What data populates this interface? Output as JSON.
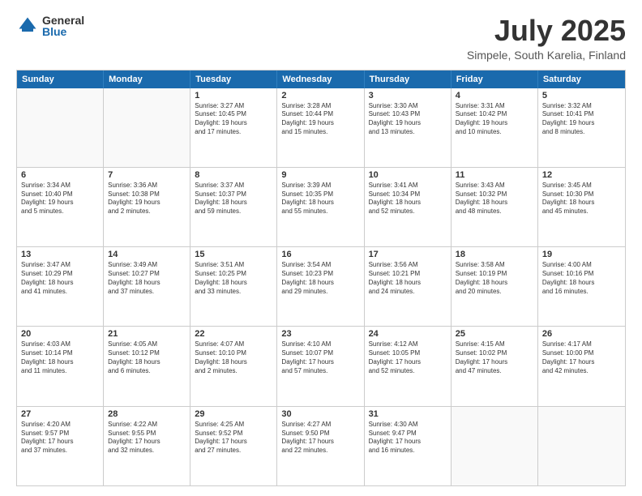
{
  "logo": {
    "general": "General",
    "blue": "Blue"
  },
  "title": "July 2025",
  "location": "Simpele, South Karelia, Finland",
  "days": [
    "Sunday",
    "Monday",
    "Tuesday",
    "Wednesday",
    "Thursday",
    "Friday",
    "Saturday"
  ],
  "weeks": [
    [
      {
        "day": "",
        "text": ""
      },
      {
        "day": "",
        "text": ""
      },
      {
        "day": "1",
        "text": "Sunrise: 3:27 AM\nSunset: 10:45 PM\nDaylight: 19 hours\nand 17 minutes."
      },
      {
        "day": "2",
        "text": "Sunrise: 3:28 AM\nSunset: 10:44 PM\nDaylight: 19 hours\nand 15 minutes."
      },
      {
        "day": "3",
        "text": "Sunrise: 3:30 AM\nSunset: 10:43 PM\nDaylight: 19 hours\nand 13 minutes."
      },
      {
        "day": "4",
        "text": "Sunrise: 3:31 AM\nSunset: 10:42 PM\nDaylight: 19 hours\nand 10 minutes."
      },
      {
        "day": "5",
        "text": "Sunrise: 3:32 AM\nSunset: 10:41 PM\nDaylight: 19 hours\nand 8 minutes."
      }
    ],
    [
      {
        "day": "6",
        "text": "Sunrise: 3:34 AM\nSunset: 10:40 PM\nDaylight: 19 hours\nand 5 minutes."
      },
      {
        "day": "7",
        "text": "Sunrise: 3:36 AM\nSunset: 10:38 PM\nDaylight: 19 hours\nand 2 minutes."
      },
      {
        "day": "8",
        "text": "Sunrise: 3:37 AM\nSunset: 10:37 PM\nDaylight: 18 hours\nand 59 minutes."
      },
      {
        "day": "9",
        "text": "Sunrise: 3:39 AM\nSunset: 10:35 PM\nDaylight: 18 hours\nand 55 minutes."
      },
      {
        "day": "10",
        "text": "Sunrise: 3:41 AM\nSunset: 10:34 PM\nDaylight: 18 hours\nand 52 minutes."
      },
      {
        "day": "11",
        "text": "Sunrise: 3:43 AM\nSunset: 10:32 PM\nDaylight: 18 hours\nand 48 minutes."
      },
      {
        "day": "12",
        "text": "Sunrise: 3:45 AM\nSunset: 10:30 PM\nDaylight: 18 hours\nand 45 minutes."
      }
    ],
    [
      {
        "day": "13",
        "text": "Sunrise: 3:47 AM\nSunset: 10:29 PM\nDaylight: 18 hours\nand 41 minutes."
      },
      {
        "day": "14",
        "text": "Sunrise: 3:49 AM\nSunset: 10:27 PM\nDaylight: 18 hours\nand 37 minutes."
      },
      {
        "day": "15",
        "text": "Sunrise: 3:51 AM\nSunset: 10:25 PM\nDaylight: 18 hours\nand 33 minutes."
      },
      {
        "day": "16",
        "text": "Sunrise: 3:54 AM\nSunset: 10:23 PM\nDaylight: 18 hours\nand 29 minutes."
      },
      {
        "day": "17",
        "text": "Sunrise: 3:56 AM\nSunset: 10:21 PM\nDaylight: 18 hours\nand 24 minutes."
      },
      {
        "day": "18",
        "text": "Sunrise: 3:58 AM\nSunset: 10:19 PM\nDaylight: 18 hours\nand 20 minutes."
      },
      {
        "day": "19",
        "text": "Sunrise: 4:00 AM\nSunset: 10:16 PM\nDaylight: 18 hours\nand 16 minutes."
      }
    ],
    [
      {
        "day": "20",
        "text": "Sunrise: 4:03 AM\nSunset: 10:14 PM\nDaylight: 18 hours\nand 11 minutes."
      },
      {
        "day": "21",
        "text": "Sunrise: 4:05 AM\nSunset: 10:12 PM\nDaylight: 18 hours\nand 6 minutes."
      },
      {
        "day": "22",
        "text": "Sunrise: 4:07 AM\nSunset: 10:10 PM\nDaylight: 18 hours\nand 2 minutes."
      },
      {
        "day": "23",
        "text": "Sunrise: 4:10 AM\nSunset: 10:07 PM\nDaylight: 17 hours\nand 57 minutes."
      },
      {
        "day": "24",
        "text": "Sunrise: 4:12 AM\nSunset: 10:05 PM\nDaylight: 17 hours\nand 52 minutes."
      },
      {
        "day": "25",
        "text": "Sunrise: 4:15 AM\nSunset: 10:02 PM\nDaylight: 17 hours\nand 47 minutes."
      },
      {
        "day": "26",
        "text": "Sunrise: 4:17 AM\nSunset: 10:00 PM\nDaylight: 17 hours\nand 42 minutes."
      }
    ],
    [
      {
        "day": "27",
        "text": "Sunrise: 4:20 AM\nSunset: 9:57 PM\nDaylight: 17 hours\nand 37 minutes."
      },
      {
        "day": "28",
        "text": "Sunrise: 4:22 AM\nSunset: 9:55 PM\nDaylight: 17 hours\nand 32 minutes."
      },
      {
        "day": "29",
        "text": "Sunrise: 4:25 AM\nSunset: 9:52 PM\nDaylight: 17 hours\nand 27 minutes."
      },
      {
        "day": "30",
        "text": "Sunrise: 4:27 AM\nSunset: 9:50 PM\nDaylight: 17 hours\nand 22 minutes."
      },
      {
        "day": "31",
        "text": "Sunrise: 4:30 AM\nSunset: 9:47 PM\nDaylight: 17 hours\nand 16 minutes."
      },
      {
        "day": "",
        "text": ""
      },
      {
        "day": "",
        "text": ""
      }
    ]
  ]
}
